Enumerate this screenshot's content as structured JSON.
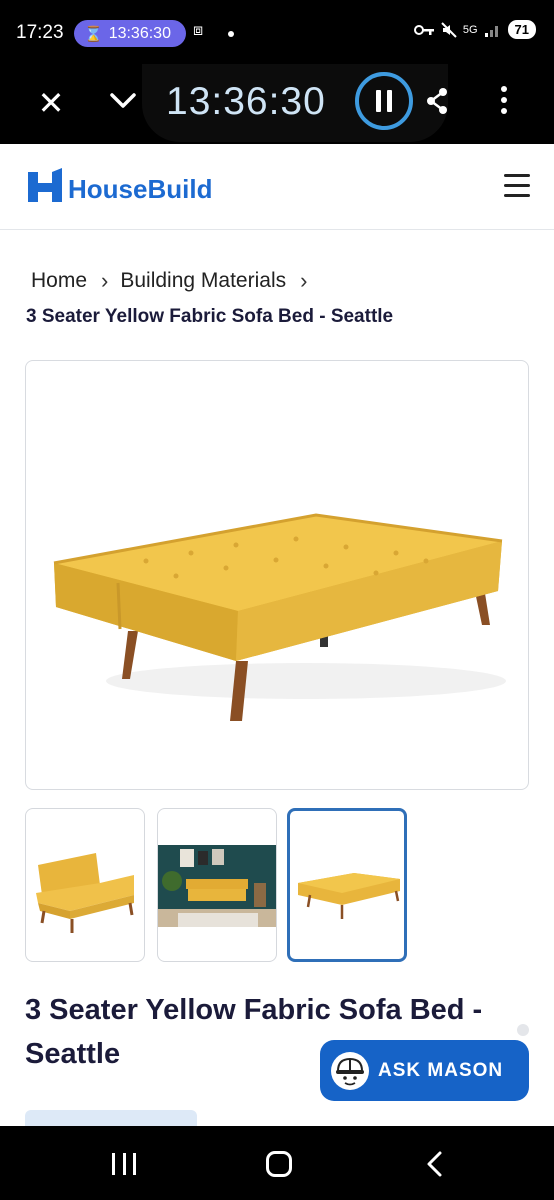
{
  "status_bar": {
    "time": "17:23",
    "timer_pill": "13:36:30",
    "network": "5G",
    "battery": "71",
    "icons": [
      "hourglass-icon",
      "screen-record-icon",
      "vpn-key-icon",
      "mute-icon",
      "signal-icon",
      "battery-icon"
    ]
  },
  "recorder": {
    "timer": "13:36:30",
    "icons": [
      "close-icon",
      "chevron-down-icon",
      "pause-icon",
      "share-icon",
      "more-icon"
    ],
    "accent": "#3e9be0"
  },
  "header": {
    "logo_text": "HouseBuild",
    "brand_color": "#1c6ad1"
  },
  "breadcrumb": {
    "items": [
      "Home",
      "Building Materials"
    ],
    "current": "3 Seater Yellow Fabric Sofa Bed - Seattle"
  },
  "product": {
    "title": "3 Seater Yellow Fabric Sofa Bed - Seattle",
    "thumbnails": [
      "sofa-upright",
      "sofa-in-living-room",
      "sofa-bed-flat"
    ],
    "selected_thumbnail": 3
  },
  "assistant": {
    "label": "ASK MASON",
    "color": "#1663c7"
  }
}
